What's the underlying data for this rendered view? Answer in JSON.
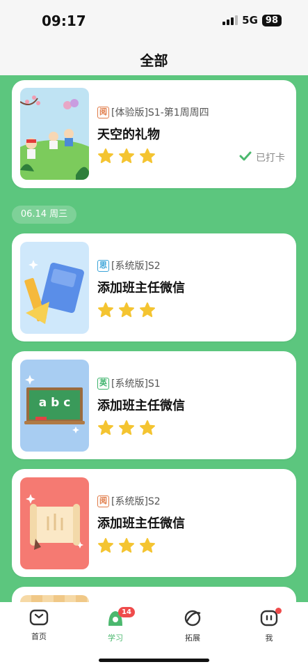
{
  "status_bar": {
    "time": "09:17",
    "network": "5G",
    "battery": "98"
  },
  "header": {
    "title": "全部"
  },
  "date_chip": "06.14 周三",
  "cards": [
    {
      "tag": "阅",
      "tag_type": "read",
      "meta": "[体验版]S1-第1周周四",
      "title": "天空的礼物",
      "stars": 3,
      "checkin": "已打卡",
      "thumb_icon": "kids-picnic-illustration"
    },
    {
      "tag": "思",
      "tag_type": "think",
      "meta": "[系统版]S2",
      "title": "添加班主任微信",
      "stars": 3,
      "thumb_icon": "book-ruler-illustration"
    },
    {
      "tag": "英",
      "tag_type": "eng",
      "meta": "[系统版]S1",
      "title": "添加班主任微信",
      "stars": 3,
      "thumb_icon": "chalkboard-illustration",
      "board_text": "a b c"
    },
    {
      "tag": "阅",
      "tag_type": "read",
      "meta": "[系统版]S2",
      "title": "添加班主任微信",
      "stars": 3,
      "thumb_icon": "scroll-illustration"
    }
  ],
  "nav": {
    "items": [
      {
        "label": "首页",
        "icon": "home-icon"
      },
      {
        "label": "学习",
        "icon": "study-icon",
        "badge": "14",
        "active": true
      },
      {
        "label": "拓展",
        "icon": "explore-icon"
      },
      {
        "label": "我",
        "icon": "profile-icon",
        "dot": true
      }
    ]
  },
  "colors": {
    "background": "#5cc67e",
    "accent": "#4bb86e",
    "star": "#f4c431",
    "badge": "#ef4b4b"
  }
}
